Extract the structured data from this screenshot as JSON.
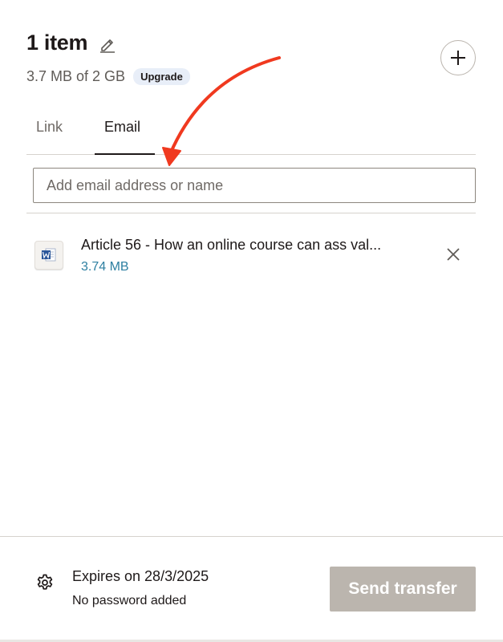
{
  "header": {
    "title": "1 item",
    "usage": "3.7 MB of 2 GB",
    "upgrade_label": "Upgrade"
  },
  "tabs": [
    {
      "label": "Link",
      "active": false
    },
    {
      "label": "Email",
      "active": true
    }
  ],
  "email_input": {
    "value": "",
    "placeholder": "Add email address or name"
  },
  "files": [
    {
      "name": "Article 56 - How an online course can ass val...",
      "size": "3.74 MB",
      "icon": "word-doc-icon"
    }
  ],
  "footer": {
    "expires": "Expires on 28/3/2025",
    "password": "No password added",
    "send_label": "Send transfer",
    "send_enabled": false
  },
  "icons": {
    "edit": "pencil-icon",
    "add": "plus-icon",
    "remove": "close-icon",
    "settings": "gear-icon",
    "annotation": "red-arrow-annotation"
  },
  "colors": {
    "accent_link": "#2d7fa1",
    "badge_bg": "#e8eef8",
    "send_disabled": "#bbb5ae",
    "annotation_arrow": "#f0391f",
    "word_blue": "#2b579a"
  }
}
